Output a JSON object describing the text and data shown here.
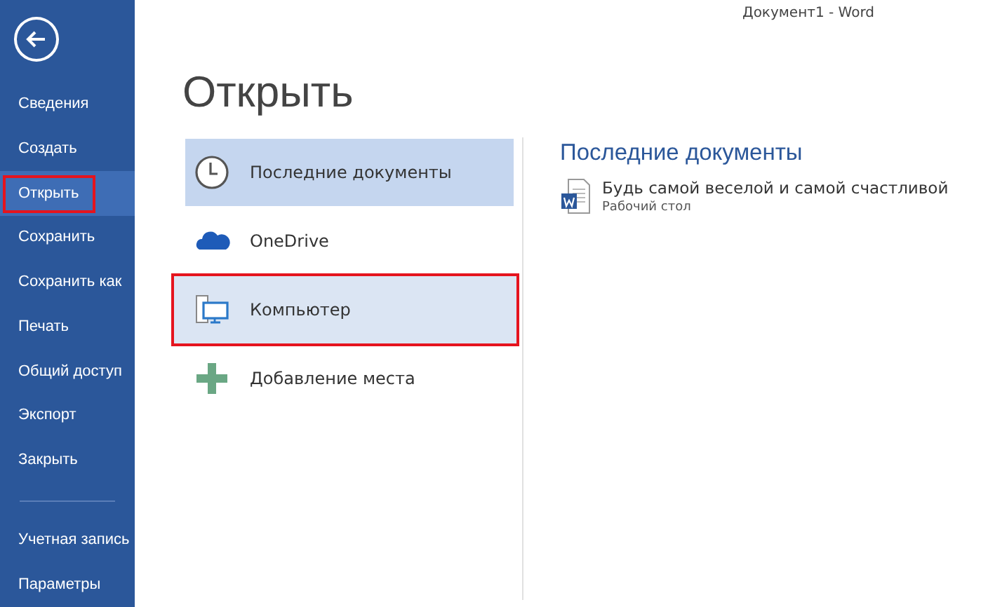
{
  "window": {
    "title": "Документ1 - Word"
  },
  "sidebar": {
    "items": [
      {
        "label": "Сведения",
        "selected": false,
        "highlighted": false
      },
      {
        "label": "Создать",
        "selected": false,
        "highlighted": false
      },
      {
        "label": "Открыть",
        "selected": true,
        "highlighted": true
      },
      {
        "label": "Сохранить",
        "selected": false,
        "highlighted": false
      },
      {
        "label": "Сохранить как",
        "selected": false,
        "highlighted": false
      },
      {
        "label": "Печать",
        "selected": false,
        "highlighted": false
      },
      {
        "label": "Общий доступ",
        "selected": false,
        "highlighted": false
      },
      {
        "label": "Экспорт",
        "selected": false,
        "highlighted": false
      },
      {
        "label": "Закрыть",
        "selected": false,
        "highlighted": false
      }
    ],
    "bottom_items": [
      {
        "label": "Учетная запись",
        "selected": false,
        "highlighted": false
      },
      {
        "label": "Параметры",
        "selected": false,
        "highlighted": false
      }
    ]
  },
  "heading": "Открыть",
  "places": [
    {
      "kind": "clock",
      "label": "Последние документы",
      "selected": true,
      "hovered": false,
      "highlighted": false
    },
    {
      "kind": "cloud",
      "label": "OneDrive",
      "selected": false,
      "hovered": false,
      "highlighted": false
    },
    {
      "kind": "computer",
      "label": "Компьютер",
      "selected": false,
      "hovered": true,
      "highlighted": true
    },
    {
      "kind": "plus",
      "label": "Добавление места",
      "selected": false,
      "hovered": false,
      "highlighted": false
    }
  ],
  "recent": {
    "title": "Последние документы",
    "documents": [
      {
        "name": "Будь самой веселой и самой счастливой",
        "location": "Рабочий стол"
      }
    ]
  }
}
